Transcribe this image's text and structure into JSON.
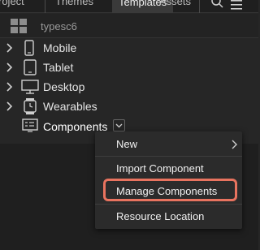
{
  "tabs": [
    {
      "label": "roject"
    },
    {
      "label": "Themes"
    },
    {
      "label": "Templates"
    },
    {
      "label": "Assets"
    }
  ],
  "project": {
    "name": "typesc6"
  },
  "tree": {
    "items": [
      {
        "label": "Mobile",
        "icon": "phone-icon"
      },
      {
        "label": "Tablet",
        "icon": "tablet-icon"
      },
      {
        "label": "Desktop",
        "icon": "monitor-icon"
      },
      {
        "label": "Wearables",
        "icon": "watch-icon"
      },
      {
        "label": "Components",
        "icon": "component-icon"
      }
    ]
  },
  "context_menu": {
    "items": [
      {
        "label": "New"
      },
      {
        "label": "Import Component"
      },
      {
        "label": "Manage Components"
      },
      {
        "label": "Resource Location"
      }
    ]
  },
  "colors": {
    "highlight": "#e8735f",
    "background": "#262626",
    "menu": "#2b2b2b"
  }
}
